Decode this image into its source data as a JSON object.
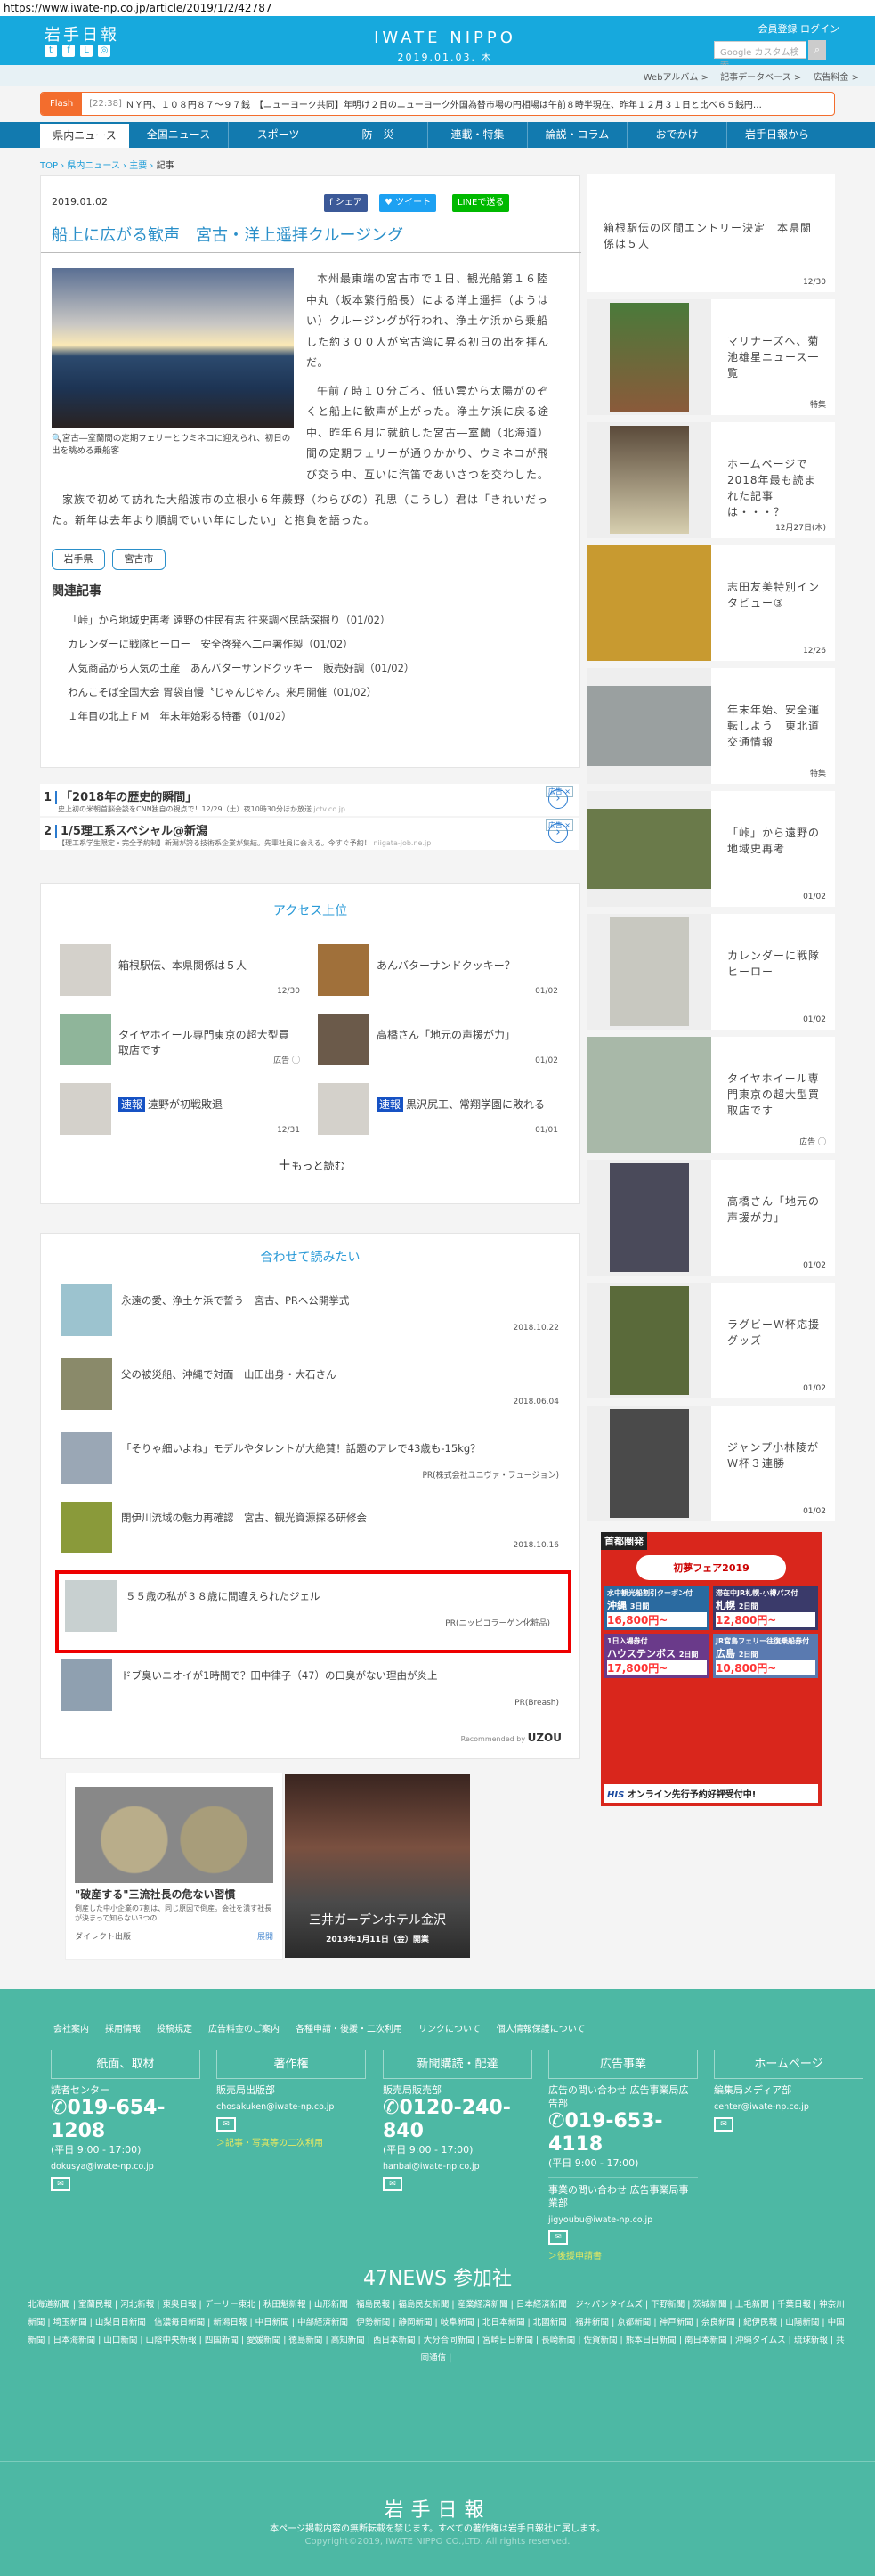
{
  "url": "https://www.iwate-np.co.jp/article/2019/1/2/42787",
  "header": {
    "logo": "岩手日報",
    "social": [
      "twitter-icon",
      "facebook-icon",
      "line-icon",
      "instagram-icon"
    ],
    "brand": "IWATE NIPPO",
    "date": "2019.01.03. 木",
    "register": "会員登録",
    "login": "ログイン",
    "search_placeholder": "Google カスタム検索",
    "search_icon": "search-icon"
  },
  "subnav": [
    "Webアルバム >",
    "記事データベース >",
    "広告料金 >"
  ],
  "flash": {
    "label": "Flash",
    "time": "[22:38]",
    "text": "ＮＹ円、１０８円８７～９７銭　【ニューヨーク共同】年明け２日のニューヨーク外国為替市場の円相場は午前８時半現在、昨年１２月３１日と比べ６５銭円…"
  },
  "nav": [
    "県内ニュース",
    "全国ニュース",
    "スポーツ",
    "防　災",
    "連載・特集",
    "論説・コラム",
    "おでかけ",
    "岩手日報から"
  ],
  "breadcrumb": [
    "TOP",
    "県内ニュース",
    "主要",
    "記事"
  ],
  "article": {
    "date": "2019.01.02",
    "share": {
      "facebook": "シェア",
      "twitter": "ツイート",
      "line": "LINEで送る"
    },
    "title": "船上に広がる歓声　宮古・洋上遥拝クルージング",
    "caption": "宮古―室蘭間の定期フェリーとウミネコに迎えられ、初日の出を眺める乗船客",
    "body": [
      "本州最東端の宮古市で１日、観光船第１６陸中丸（坂本繁行船長）による洋上遥拝（ようはい）クルージングが行われ、浄土ケ浜から乗船した約３００人が宮古湾に昇る初日の出を拝んだ。",
      "午前７時１０分ごろ、低い雲から太陽がのぞくと船上に歓声が上がった。浄土ケ浜に戻る途中、昨年６月に就航した宮古―室蘭（北海道）間の定期フェリーが通りかかり、ウミネコが飛び交う中、互いに汽笛であいさつを交わした。"
    ],
    "body_last": "家族で初めて訪れた大船渡市の立根小６年蕨野（わらびの）孔思（こうし）君は「きれいだった。新年は去年より順調でいい年にしたい」と抱負を語った。",
    "tags": [
      "岩手県",
      "宮古市"
    ],
    "related_heading": "関連記事",
    "related": [
      "「峠」から地域史再考 遠野の住民有志 往来調べ民話深掘り（01/02）",
      "カレンダーに戦隊ヒーロー　安全啓発へ二戸署作製（01/02）",
      "人気商品から人気の土産　あんバターサンドクッキー　販売好調（01/02）",
      "わんこそば全国大会 胃袋自慢〝じゃんじゃん〟来月開催（01/02）",
      "１年目の北上ＦＭ　年末年始彩る特番（01/02）"
    ]
  },
  "promo": [
    {
      "n": "1",
      "title": "「2018年の歴史的瞬間」",
      "desc": "史上初の米朝首脳会談をCNN独自の視点で！12/29（土）夜10時30分ほか放送",
      "domain": "jctv.co.jp",
      "ad": "広告 ×"
    },
    {
      "n": "2",
      "title": "1/5理工系スペシャル@新潟",
      "desc": "【理工系学生限定・完全予約制】新潟が誇る技術系企業が集結。先輩社員に会える。今すぐ予約！",
      "domain": "niigata-job.ne.jp",
      "ad": "広告 ×"
    }
  ],
  "ranking": {
    "heading": "アクセス上位",
    "items": [
      {
        "title": "箱根駅伝、本県関係は５人",
        "date": "12/30"
      },
      {
        "title": "あんバターサンドクッキー？",
        "date": "01/02"
      },
      {
        "title": "タイヤホイール専門東京の超大型買取店です",
        "date": "広告 ⓘ"
      },
      {
        "title": "高橋さん「地元の声援が力」",
        "date": "01/02"
      },
      {
        "badge": "速報",
        "title": "遠野が初戦敗退",
        "date": "12/31"
      },
      {
        "badge": "速報",
        "title": "黒沢尻工、常翔学園に敗れる",
        "date": "01/01"
      }
    ],
    "more": "もっと読む"
  },
  "recommend": {
    "heading": "合わせて読みたい",
    "items": [
      {
        "title": "永遠の愛、浄土ケ浜で誓う　宮古、PRへ公開挙式",
        "date": "2018.10.22"
      },
      {
        "title": "父の被災船、沖縄で対面　山田出身・大石さん",
        "date": "2018.06.04"
      },
      {
        "title": "「そりゃ細いよね」モデルやタレントが大絶賛！話題のアレで43歳も-15kg？",
        "date": "PR(株式会社ユニヴァ・フュージョン)"
      },
      {
        "title": "閉伊川流域の魅力再確認　宮古、観光資源探る研修会",
        "date": "2018.10.16"
      },
      {
        "title": "５５歳の私が３８歳に間違えられたジェル",
        "date": "PR(ニッピコラーゲン化粧品)"
      },
      {
        "title": "ドブ臭いニオイが1時間で？田中律子（47）の口臭がない理由が炎上",
        "date": "PR(Breash)"
      }
    ],
    "recommended_by": "Recommended by",
    "uzou": "UZOU"
  },
  "ads": {
    "coin_title": "\"破産する\"三流社長の危ない習慣",
    "coin_desc": "倒産した中小企業の7割は、同じ原因で倒産。会社を潰す社長が決まって知らない3つの...",
    "coin_source": "ダイレクト出版",
    "coin_open": "展開",
    "hotel_title": "三井ガーデンホテル金沢",
    "hotel_date": "2019年1月11日（金）開業"
  },
  "sidebar": {
    "items": [
      {
        "title": "箱根駅伝の区間エントリー決定　本県関係は５人",
        "date": "12/30"
      },
      {
        "title": "マリナーズへ、菊池雄星ニュース一覧",
        "date": "特集"
      },
      {
        "title": "ホームページで2018年最も読まれた記事は・・・？",
        "date": "12月27日(木)"
      },
      {
        "title": "志田友美特別インタビュー③",
        "date": "12/26"
      },
      {
        "title": "年末年始、安全運転しよう　東北道交通情報",
        "date": "特集"
      },
      {
        "title": "「峠」から遠野の地域史再考",
        "date": "01/02"
      },
      {
        "title": "カレンダーに戦隊ヒーロー",
        "date": "01/02"
      },
      {
        "title": "タイヤホイール専門東京の超大型買取店です",
        "date": "広告 ⓘ"
      },
      {
        "title": "高橋さん「地元の声援が力」",
        "date": "01/02"
      },
      {
        "title": "ラグビーＷ杯応援グッズ",
        "date": "01/02"
      },
      {
        "title": "ジャンプ小林陵がＷ杯３連勝",
        "date": "01/02"
      }
    ],
    "ad": {
      "top": "首都圏発",
      "fair": "初夢フェア2019",
      "deals": [
        {
          "place": "沖縄",
          "days": "3日間",
          "price": "16,800円~",
          "note": "水中観光船割引クーポン付"
        },
        {
          "place": "札幌",
          "days": "2日間",
          "price": "12,800円~",
          "note": "滞在中JR札幌-小樽パス付"
        },
        {
          "place": "ハウステンボス",
          "days": "2日間",
          "price": "17,800円~",
          "note": "1日入場券付"
        },
        {
          "place": "広島",
          "days": "2日間",
          "price": "10,800円~",
          "note": "JR宮島フェリー往復乗船券付"
        }
      ],
      "his": "HIS",
      "cta": "オンライン先行予約好評受付中!"
    }
  },
  "footer": {
    "links": [
      "会社案内",
      "採用情報",
      "投稿規定",
      "広告料金のご案内",
      "各種申請・後援・二次利用",
      "リンクについて",
      "個人情報保護について"
    ],
    "columns": [
      {
        "box": "紙面、取材",
        "dept": "読者センター",
        "phone": "019-654-1208",
        "hours": "(平日 9:00 - 17:00)",
        "email": "dokusya@iwate-np.co.jp"
      },
      {
        "box": "著作権",
        "dept": "販売局出版部",
        "email": "chosakuken@iwate-np.co.jp",
        "link": "＞記事・写真等の二次利用"
      },
      {
        "box": "新聞購読・配達",
        "dept": "販売局販売部",
        "phone": "0120-240-840",
        "hours": "(平日 9:00 - 17:00)",
        "email": "hanbai@iwate-np.co.jp"
      },
      {
        "box": "広告事業",
        "dept": "広告の問い合わせ 広告事業局広告部",
        "phone": "019-653-4118",
        "hours": "(平日 9:00 - 17:00)",
        "dept2": "事業の問い合わせ 広告事業局事業部",
        "email": "jigyoubu@iwate-np.co.jp",
        "link": "＞後援申請書"
      },
      {
        "box": "ホームページ",
        "dept": "編集局メディア部",
        "email": "center@iwate-np.co.jp"
      }
    ],
    "news47_heading": "47NEWS 参加社",
    "news47": [
      "北海道新聞",
      "室蘭民報",
      "河北新報",
      "東奥日報",
      "デーリー東北",
      "秋田魁新報",
      "山形新聞",
      "福島民報",
      "福島民友新聞",
      "産業経済新聞",
      "日本経済新聞",
      "ジャパンタイムズ",
      "下野新聞",
      "茨城新聞",
      "上毛新聞",
      "千葉日報",
      "神奈川新聞",
      "埼玉新聞",
      "山梨日日新聞",
      "信濃毎日新聞",
      "新潟日報",
      "中日新聞",
      "中部経済新聞",
      "伊勢新聞",
      "静岡新聞",
      "岐阜新聞",
      "北日本新聞",
      "北國新聞",
      "福井新聞",
      "京都新聞",
      "神戸新聞",
      "奈良新聞",
      "紀伊民報",
      "山陽新聞",
      "中国新聞",
      "日本海新聞",
      "山口新聞",
      "山陰中央新報",
      "四国新聞",
      "愛媛新聞",
      "徳島新聞",
      "高知新聞",
      "西日本新聞",
      "大分合同新聞",
      "宮崎日日新聞",
      "長崎新聞",
      "佐賀新聞",
      "熊本日日新聞",
      "南日本新聞",
      "沖縄タイムス",
      "琉球新報",
      "共同通信"
    ],
    "logo": "岩手日報",
    "notice": "本ページ掲載内容の無断転載を禁じます。すべての著作権は岩手日報社に属します。",
    "copyright": "Copyright©2019, IWATE NIPPO CO.,LTD. All rights reserved."
  },
  "colors": {
    "header": "#17a9dd",
    "nav": "#127aaf",
    "flash": "#f36d2d",
    "footer": "#4db8a4",
    "title": "#2a8fc9",
    "highlight": "#e00000"
  }
}
